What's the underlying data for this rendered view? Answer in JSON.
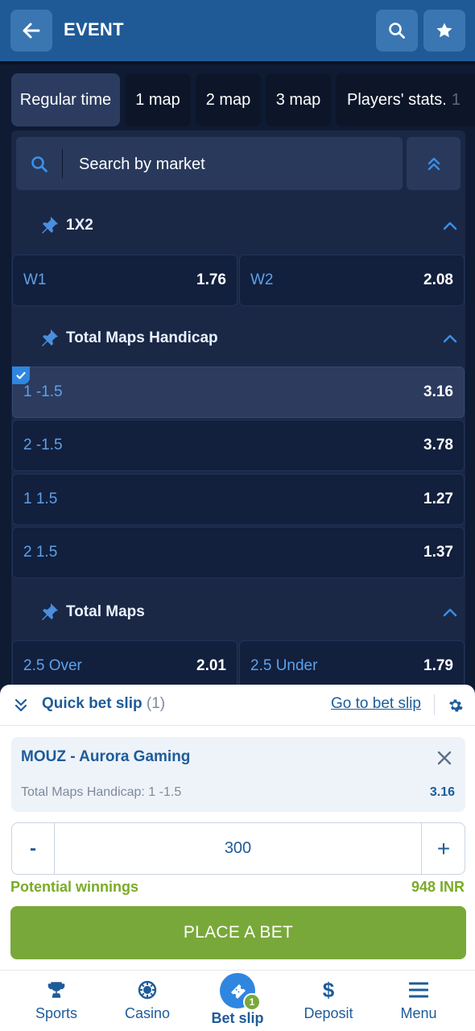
{
  "header": {
    "title": "EVENT",
    "back_icon": "arrow-left-icon",
    "search_icon": "search-icon",
    "favorite_icon": "star-icon"
  },
  "tabs": [
    {
      "label": "Regular time",
      "active": true
    },
    {
      "label": "1 map"
    },
    {
      "label": "2 map"
    },
    {
      "label": "3 map"
    },
    {
      "label": "Players' stats."
    },
    {
      "label": "1"
    }
  ],
  "search": {
    "placeholder": "Search by market"
  },
  "markets": [
    {
      "title": "1X2",
      "outcomes": [
        {
          "label": "W1",
          "odd": "1.76"
        },
        {
          "label": "W2",
          "odd": "2.08"
        }
      ]
    },
    {
      "title": "Total Maps Handicap",
      "outcomes": [
        {
          "label": "1 -1.5",
          "odd": "3.16",
          "selected": true
        },
        {
          "label": "2 -1.5",
          "odd": "3.78"
        },
        {
          "label": "1 1.5",
          "odd": "1.27"
        },
        {
          "label": "2 1.5",
          "odd": "1.37"
        }
      ]
    },
    {
      "title": "Total Maps",
      "outcomes": [
        {
          "label": "2.5 Over",
          "odd": "2.01"
        },
        {
          "label": "2.5 Under",
          "odd": "1.79"
        }
      ]
    }
  ],
  "quick_bet_slip": {
    "title": "Quick bet slip",
    "count": "(1)",
    "go_link": "Go to bet slip",
    "bet": {
      "event": "MOUZ - Aurora Gaming",
      "market": "Total Maps Handicap: 1 -1.5",
      "odd": "3.16"
    },
    "stake": {
      "minus": "-",
      "value": "300",
      "plus": "+"
    },
    "potential_label": "Potential winnings",
    "potential_value": "948 INR",
    "place_button": "PLACE A BET"
  },
  "nav": [
    {
      "label": "Sports",
      "icon": "trophy-icon"
    },
    {
      "label": "Casino",
      "icon": "casino-chip-icon"
    },
    {
      "label": "Bet slip",
      "icon": "ticket-icon",
      "active": true,
      "badge": "1"
    },
    {
      "label": "Deposit",
      "icon": "dollar-icon"
    },
    {
      "label": "Menu",
      "icon": "hamburger-icon"
    }
  ],
  "colors": {
    "header": "#1f5a97",
    "background": "#0f1a33",
    "accent": "#2f86e0",
    "green": "#79a83a",
    "link": "#1e5c99"
  }
}
